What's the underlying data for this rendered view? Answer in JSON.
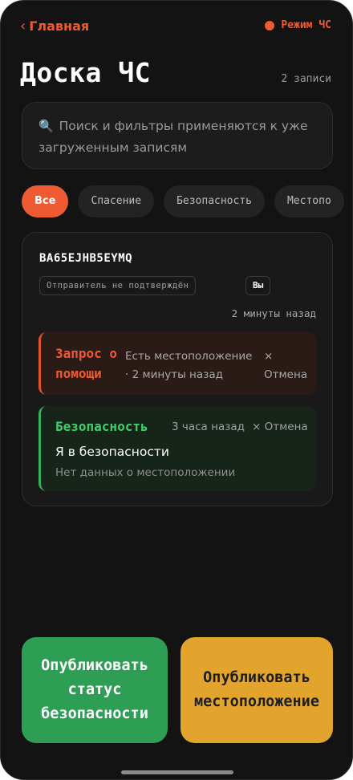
{
  "nav": {
    "back_label": "Главная",
    "mode_label": "Режим ЧС"
  },
  "header": {
    "title": "Доска ЧС",
    "count": "2 записи"
  },
  "search": {
    "placeholder": "Поиск и фильтры применяются к уже загруженным записям"
  },
  "filters": [
    {
      "label": "Все",
      "active": true
    },
    {
      "label": "Спасение",
      "active": false
    },
    {
      "label": "Безопасность",
      "active": false
    },
    {
      "label": "Местопо",
      "active": false
    }
  ],
  "card": {
    "sender_id": "BA65EJHB5EYMQ",
    "sender_status": "Отправитель не подтверждён",
    "you_badge": "Вы",
    "ago": "2 минуты назад",
    "entries": [
      {
        "type_line1": "Запрос о",
        "type_line2": "помощи",
        "detail_line1": "Есть местоположение",
        "detail_line2": "· 2 минуты назад",
        "cancel_icon": "×",
        "cancel_label": "Отмена"
      },
      {
        "type": "Безопасность",
        "time": "3 часа назад",
        "cancel": "× Отмена",
        "message": "Я в безопасности",
        "location": "Нет данных о местоположении"
      }
    ]
  },
  "actions": {
    "publish_status": [
      "Опубликовать",
      "статус",
      "безопасности"
    ],
    "publish_location": [
      "Опубликовать",
      "местоположение"
    ]
  },
  "colors": {
    "accent": "#ee5a31",
    "background": "#131313",
    "safe": "#3fcf6a",
    "publish_green": "#2f9e55",
    "publish_amber": "#e2a42d"
  },
  "icons": {
    "search": "search-icon",
    "back": "chevron-left-icon",
    "mode": "status-dot-icon"
  }
}
